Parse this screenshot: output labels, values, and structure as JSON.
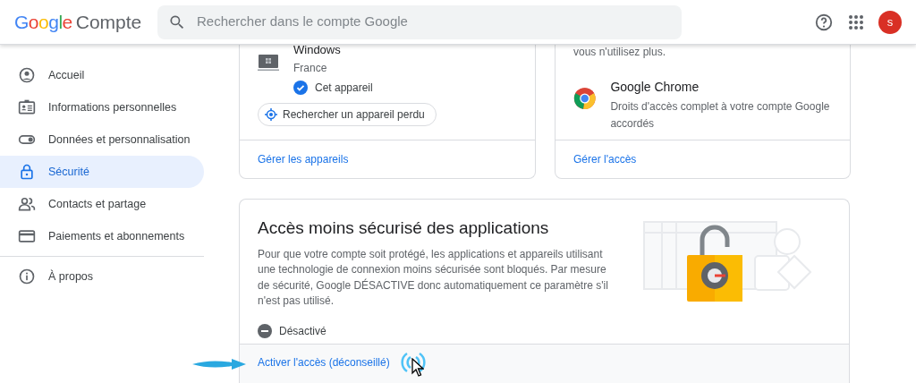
{
  "header": {
    "logo": "Google",
    "product": "Compte",
    "search": {
      "placeholder": "Rechercher dans le compte Google"
    },
    "avatar": "s"
  },
  "sidebar": {
    "items": [
      {
        "label": "Accueil",
        "selected": false
      },
      {
        "label": "Informations personnelles",
        "selected": false
      },
      {
        "label": "Données et personnalisation",
        "selected": false
      },
      {
        "label": "Sécurité",
        "selected": true
      },
      {
        "label": "Contacts et partage",
        "selected": false
      },
      {
        "label": "Paiements et abonnements",
        "selected": false
      },
      {
        "label": "À propos",
        "selected": false
      }
    ]
  },
  "devices_card": {
    "device_name": "Windows",
    "location": "France",
    "current_device": "Cet appareil",
    "find_button": "Rechercher un appareil perdu",
    "footer_link": "Gérer les appareils"
  },
  "apps_card": {
    "intro_tail": "vous n'utilisez plus.",
    "app": {
      "name": "Google Chrome",
      "description": "Droits d'accès complet à votre compte Google accordés"
    },
    "footer_link": "Gérer l'accès"
  },
  "less_secure_card": {
    "title": "Accès moins sécurisé des applications",
    "description": "Pour que votre compte soit protégé, les applications et appareils utilisant une technologie de connexion moins sécurisée sont bloqués. Par mesure de sécurité, Google DÉSACTIVE donc automatiquement ce paramètre s'il n'est pas utilisé.",
    "status": {
      "label": "Désactivé",
      "on": false
    },
    "action_link": "Activer l'accès (déconseillé)"
  }
}
